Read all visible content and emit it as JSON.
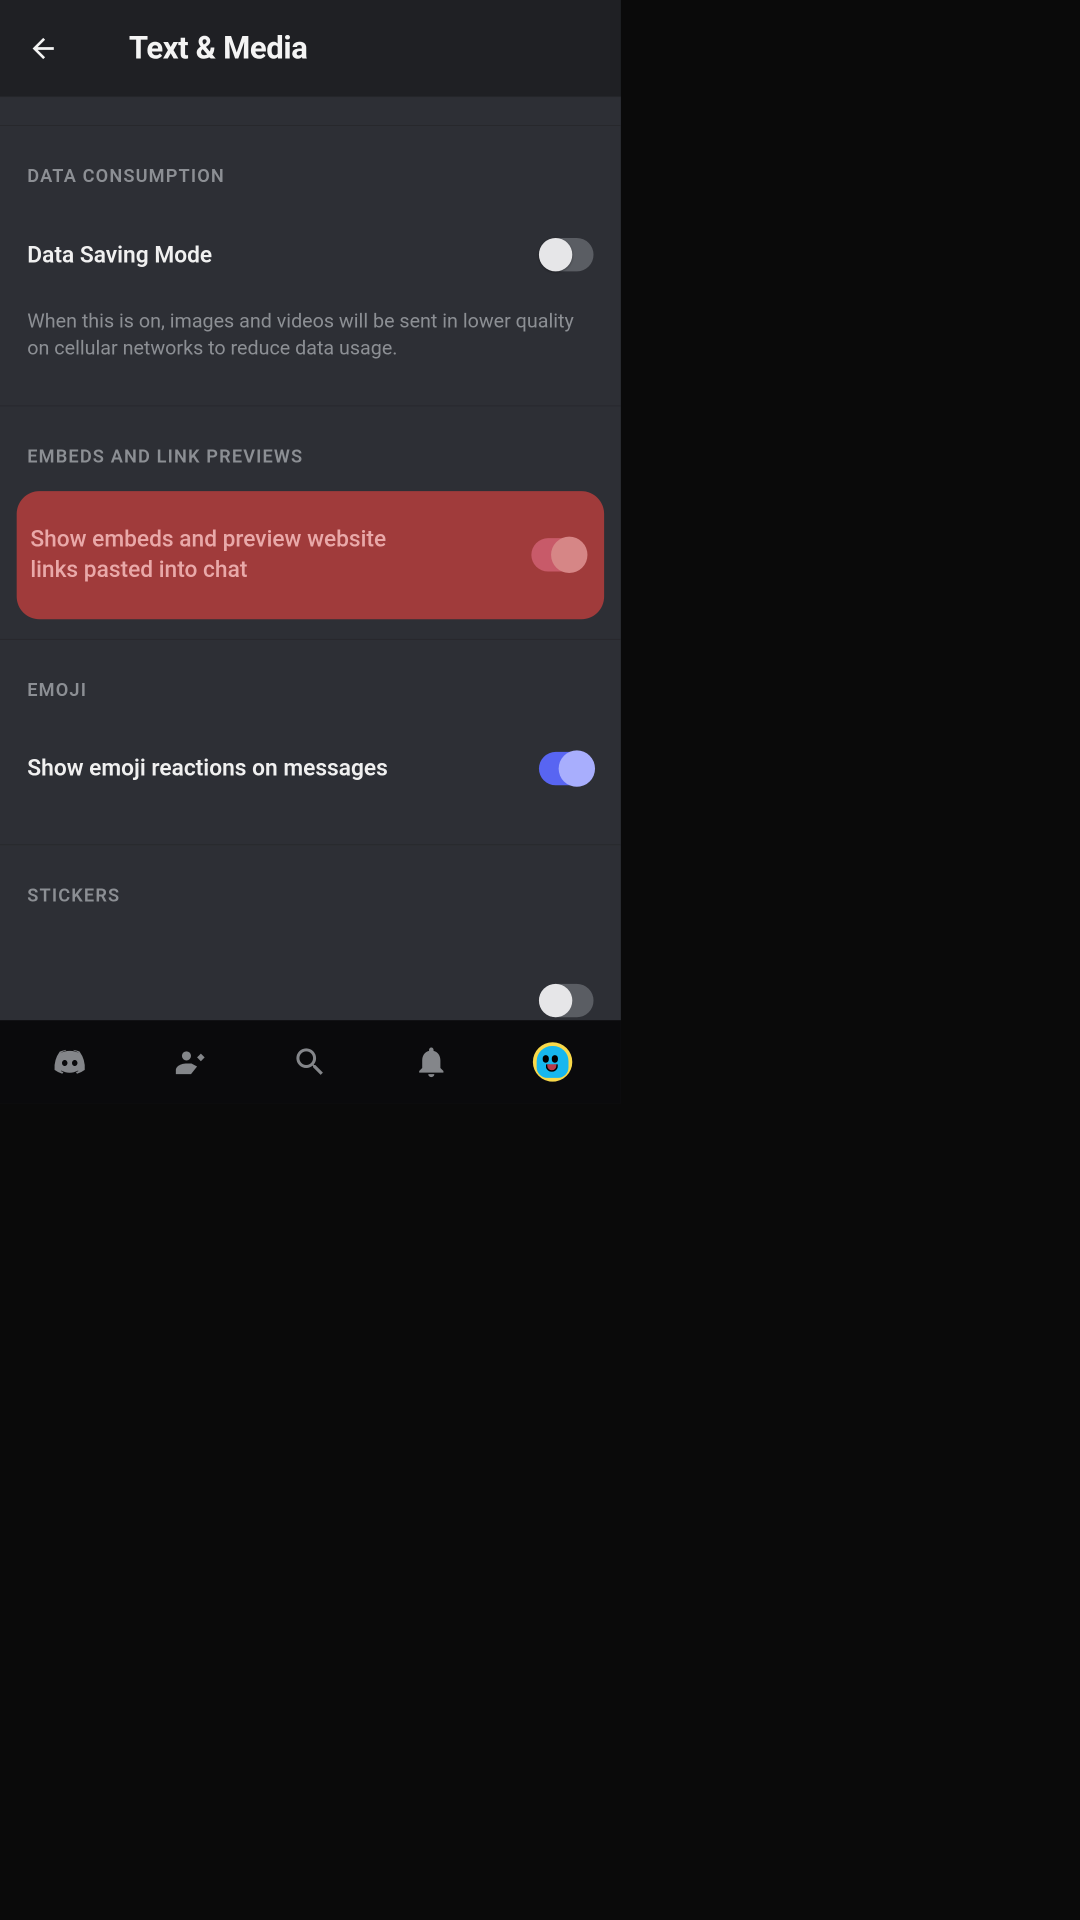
{
  "header": {
    "title": "Text & Media"
  },
  "sections": {
    "data_consumption": {
      "heading": "DATA CONSUMPTION",
      "setting_label": "Data Saving Mode",
      "setting_on": false,
      "description": "When this is on, images and videos will be sent in lower quality on cellular networks to reduce data usage."
    },
    "embeds": {
      "heading": "EMBEDS AND LINK PREVIEWS",
      "setting_label": "Show embeds and preview website links pasted into chat",
      "setting_on": true
    },
    "emoji": {
      "heading": "EMOJI",
      "setting_label": "Show emoji reactions on messages",
      "setting_on": true
    },
    "stickers": {
      "heading": "STICKERS"
    }
  },
  "colors": {
    "highlight_bg": "#a03b3b",
    "toggle_on_blue": "#5865f2",
    "toggle_off_gray": "#5a5d63"
  }
}
